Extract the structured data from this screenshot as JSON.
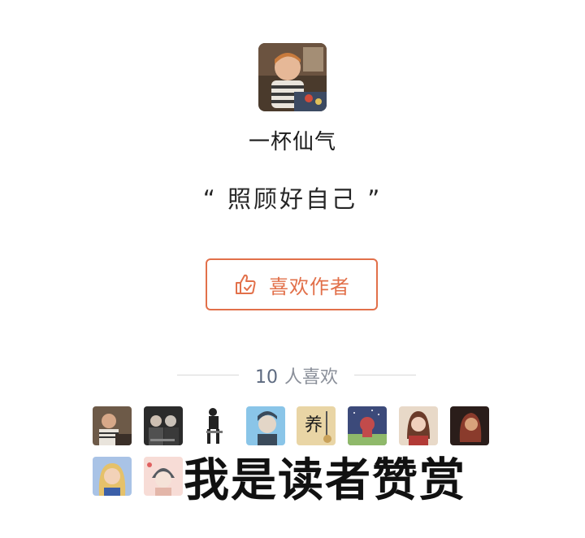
{
  "author": {
    "name": "一杯仙气",
    "quote": "“ 照顾好自己 ”",
    "avatar_icon": "author-photo"
  },
  "like_button": {
    "label": "喜欢作者",
    "icon": "thumbs-up-icon",
    "accent_color": "#e2704a"
  },
  "likes": {
    "count": "10",
    "suffix": "人喜欢"
  },
  "likers": [
    {
      "name": "liker-1",
      "palette": [
        "#6d5a48",
        "#c8a784",
        "#3a2f28"
      ]
    },
    {
      "name": "liker-2",
      "palette": [
        "#2b2b2b",
        "#c9c1b8",
        "#505050"
      ]
    },
    {
      "name": "liker-3",
      "palette": [
        "#ffffff",
        "#222222",
        "#777777"
      ]
    },
    {
      "name": "liker-4",
      "palette": [
        "#8ac5e8",
        "#e3d6c7",
        "#3a4a5a"
      ]
    },
    {
      "name": "liker-5",
      "palette": [
        "#e9d5a5",
        "#1d1d1d",
        "#c9a25a"
      ]
    },
    {
      "name": "liker-6",
      "palette": [
        "#3c4a7a",
        "#c24b4b",
        "#8fb96a"
      ]
    },
    {
      "name": "liker-7",
      "palette": [
        "#e8d9c8",
        "#6b3b2a",
        "#b23a36"
      ]
    },
    {
      "name": "liker-8",
      "palette": [
        "#2a1d1a",
        "#8a3b2c",
        "#d8a27b"
      ]
    },
    {
      "name": "liker-9",
      "palette": [
        "#a9c3e6",
        "#f2d2b8",
        "#e5c16a"
      ]
    },
    {
      "name": "liker-10",
      "palette": [
        "#f7dcd6",
        "#555a60",
        "#e3b6a9"
      ]
    }
  ],
  "banner_text": "我是读者赞赏"
}
